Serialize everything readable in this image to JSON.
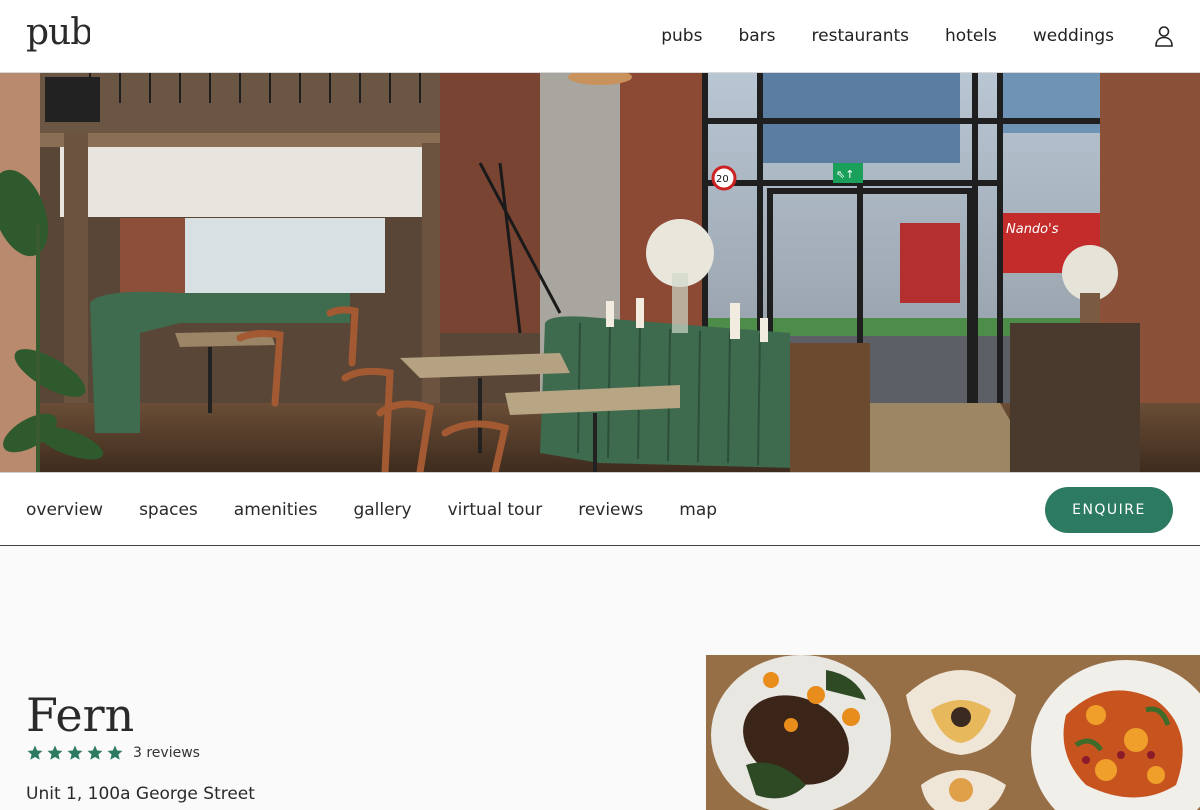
{
  "header": {
    "logo": "pub",
    "nav": [
      "pubs",
      "bars",
      "restaurants",
      "hotels",
      "weddings"
    ],
    "user_icon": "user-icon"
  },
  "hero": {
    "image": "restaurant-interior-photo",
    "exit_sign": "⇖↑",
    "shop_sign": "Nando's",
    "road_sign": "20"
  },
  "subnav": {
    "items": [
      "overview",
      "spaces",
      "amenities",
      "gallery",
      "virtual tour",
      "reviews",
      "map"
    ],
    "enquire_label": "ENQUIRE"
  },
  "venue": {
    "name": "Fern",
    "rating": 5,
    "reviews_label": "3 reviews",
    "address": "Unit 1, 100a George Street"
  },
  "colors": {
    "accent": "#2d7a62",
    "star": "#2d7a62"
  },
  "food_photo": "food-dishes-photo"
}
